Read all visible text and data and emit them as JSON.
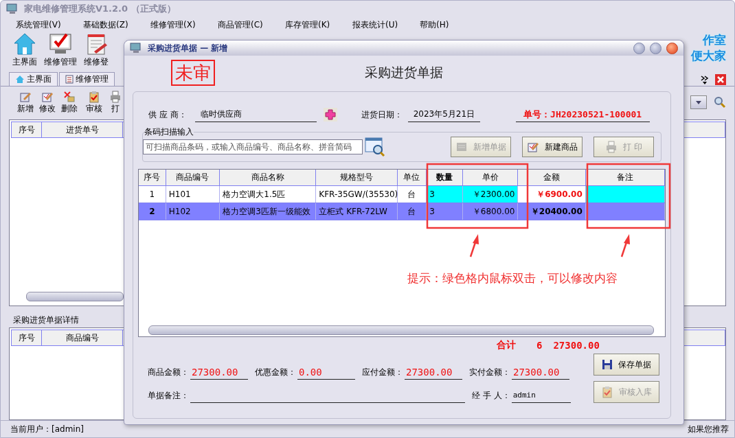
{
  "window": {
    "title": "家电维修管理系统V1.2.0 （正式版）"
  },
  "menu": [
    "系统管理(V)",
    "基础数据(Z)",
    "维修管理(X)",
    "商品管理(C)",
    "库存管理(K)",
    "报表统计(U)",
    "帮助(H)"
  ],
  "toolbar": [
    {
      "label": "主界面",
      "kind": "home"
    },
    {
      "label": "维修管理",
      "kind": "check"
    },
    {
      "label": "维修登",
      "kind": "notepad"
    }
  ],
  "brand": [
    "作室",
    "便大家"
  ],
  "tabs": [
    {
      "label": "主界面",
      "selected": false
    },
    {
      "label": "维修管理",
      "selected": false
    }
  ],
  "list_toolbar": [
    {
      "label": "新增",
      "kind": "new"
    },
    {
      "label": "修改",
      "kind": "edit"
    },
    {
      "label": "删除",
      "kind": "delete"
    },
    {
      "label": "审核",
      "kind": "audit"
    },
    {
      "label": "打",
      "kind": "print"
    }
  ],
  "orders_table": {
    "columns": [
      "序号",
      "进货单号"
    ]
  },
  "details": {
    "title": "采购进货单据详情",
    "columns": [
      "序号",
      "商品编号"
    ]
  },
  "status_bar": {
    "user": "当前用户：[admin]",
    "notice": "如果您推荐"
  },
  "dialog": {
    "title": "采购进货单据 — 新增",
    "stamp": "未审",
    "heading": "采购进货单据",
    "supplier": {
      "label": "供 应 商：",
      "value": "临时供应商"
    },
    "date": {
      "label": "进货日期：",
      "value": "2023年5月21日"
    },
    "order_no": "单号：JH20230521-100001",
    "scan": {
      "title": "条码扫描输入",
      "placeholder": "可扫描商品条码，或输入商品编号、商品名称、拼音简码"
    },
    "actions": [
      {
        "label": "新增单据",
        "kind": "doc",
        "disabled": true
      },
      {
        "label": "新建商品",
        "kind": "edit",
        "disabled": false
      },
      {
        "label": "打 印",
        "kind": "print",
        "disabled": true
      }
    ],
    "grid": {
      "columns": [
        {
          "label": "序号",
          "kind": "index",
          "editable": false,
          "emphasized": false
        },
        {
          "label": "商品编号",
          "kind": "text",
          "editable": false,
          "emphasized": false
        },
        {
          "label": "商品名称",
          "kind": "text",
          "editable": false,
          "emphasized": false
        },
        {
          "label": "规格型号",
          "kind": "text",
          "editable": false,
          "emphasized": false
        },
        {
          "label": "单位",
          "kind": "center",
          "editable": false,
          "emphasized": false
        },
        {
          "label": "数量",
          "kind": "text",
          "editable": true,
          "emphasized": true
        },
        {
          "label": "单价",
          "kind": "price",
          "editable": true,
          "emphasized": false
        },
        {
          "label": "金额",
          "kind": "amount",
          "editable": false,
          "emphasized": false
        },
        {
          "label": "备注",
          "kind": "text",
          "editable": true,
          "emphasized": false
        }
      ],
      "rows": [
        {
          "selected": false,
          "cells": [
            "1",
            "H101",
            "格力空调大1.5匹",
            "KFR-35GW/(35530)",
            "台",
            "3",
            "￥2300.00",
            "￥6900.00"
          ]
        },
        {
          "selected": true,
          "cells": [
            "2",
            "H102",
            "格力空调3匹新一级能效",
            "立柜式 KFR-72LW",
            "台",
            "3",
            "￥6800.00",
            "￥20400.00"
          ]
        }
      ]
    },
    "hint": "提示：绿色格内鼠标双击，可以修改内容",
    "total": {
      "label": "合计",
      "quantity": "6",
      "amount": "27300.00"
    },
    "amounts": [
      {
        "label": "商品金额：",
        "value": "27300.00"
      },
      {
        "label": "优惠金额：",
        "value": "0.00"
      },
      {
        "label": "应付金额：",
        "value": "27300.00"
      },
      {
        "label": "实付金额：",
        "value": "27300.00"
      }
    ],
    "remark": {
      "label": "单据备注："
    },
    "handler": {
      "label": "经 手 人：",
      "value": "admin"
    },
    "buttons": [
      {
        "label": "保存单据",
        "kind": "save",
        "disabled": false
      },
      {
        "label": "审核入库",
        "kind": "audit",
        "disabled": true
      }
    ]
  }
}
